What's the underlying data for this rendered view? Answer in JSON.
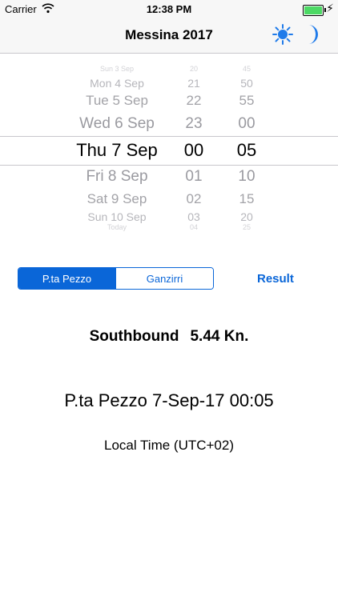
{
  "status_bar": {
    "carrier": "Carrier",
    "time": "12:38 PM",
    "battery_level": 1.0
  },
  "nav": {
    "title": "Messina 2017",
    "icons": [
      "sun-icon",
      "moon-icon"
    ]
  },
  "picker": {
    "dates": [
      "Sun 3 Sep",
      "Mon 4 Sep",
      "Tue 5 Sep",
      "Wed 6 Sep",
      "Thu 7 Sep",
      "Fri 8 Sep",
      "Sat 9 Sep",
      "Sun 10 Sep",
      "Today"
    ],
    "hours": [
      "20",
      "21",
      "22",
      "23",
      "00",
      "01",
      "02",
      "03",
      "04"
    ],
    "minutes": [
      "45",
      "50",
      "55",
      "00",
      "05",
      "10",
      "15",
      "20",
      "25"
    ],
    "selected_index": 4
  },
  "segmented": {
    "options": [
      "P.ta Pezzo",
      "Ganzirri"
    ],
    "selected": "P.ta Pezzo"
  },
  "result_label": "Result",
  "output": {
    "direction": "Southbound",
    "speed": "5.44 Kn.",
    "location_time": "P.ta Pezzo 7-Sep-17 00:05",
    "timezone": "Local Time (UTC+02)"
  },
  "colors": {
    "accent": "#0a66d8",
    "bar_bg": "#f7f7f7",
    "battery": "#4cd964"
  }
}
